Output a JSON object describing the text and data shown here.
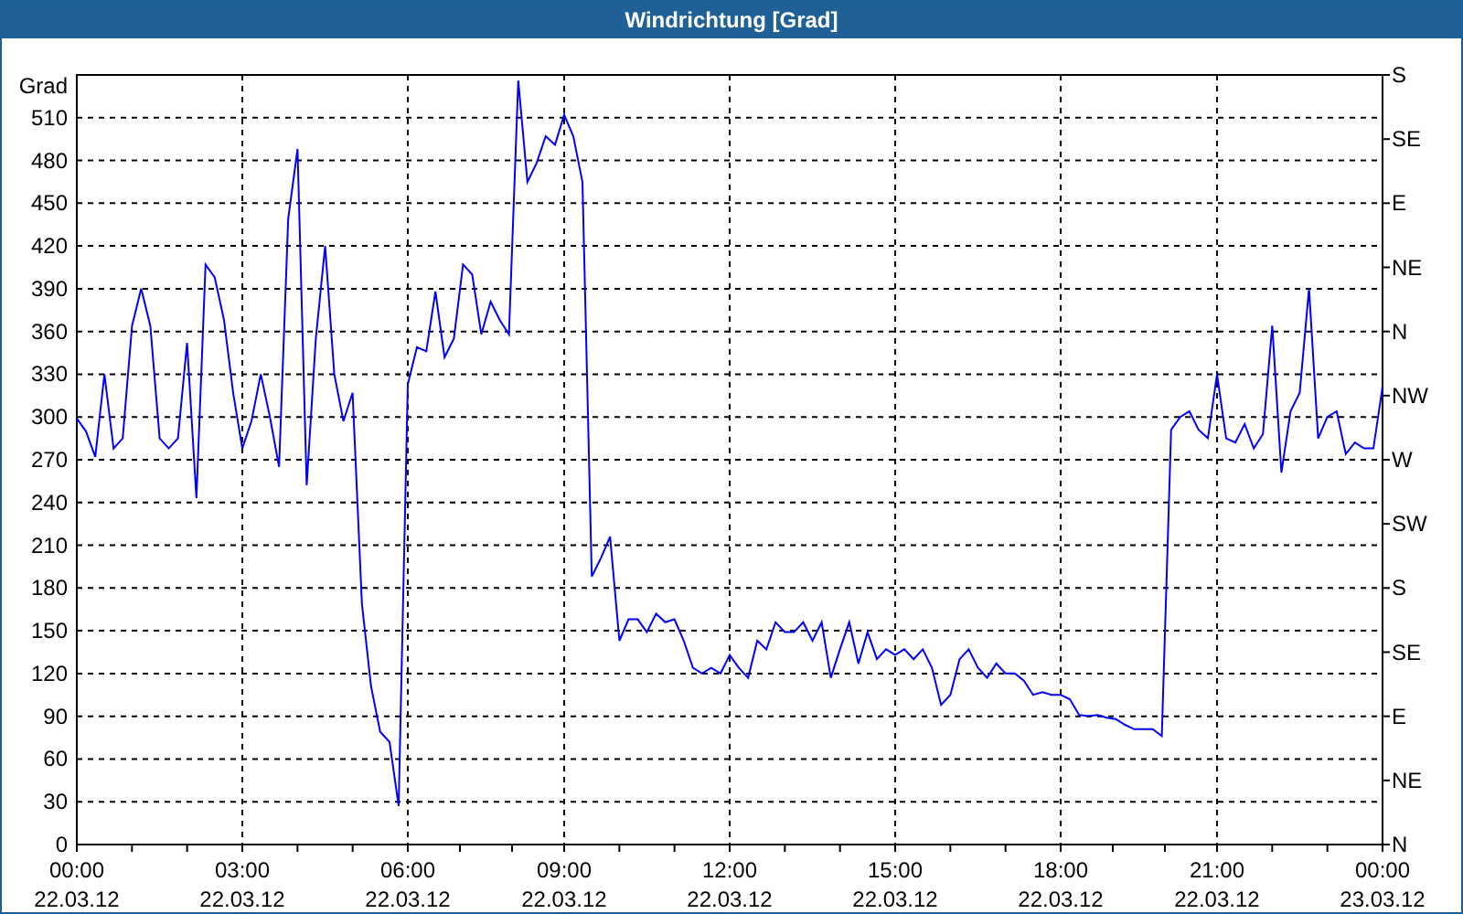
{
  "window": {
    "title": "Windrichtung [Grad]"
  },
  "chart": {
    "chart_data": {
      "type": "line",
      "ylabel": "Grad",
      "categories": [
        "00:00 22.03.12",
        null,
        null,
        null,
        null,
        null,
        null,
        null,
        null,
        null,
        null,
        null,
        null,
        null,
        null,
        null,
        null,
        null,
        "03:00 22.03.12",
        null,
        null,
        null,
        null,
        null,
        null,
        null,
        null,
        null,
        null,
        null,
        null,
        null,
        null,
        null,
        null,
        null,
        "06:00 22.03.12",
        null,
        null,
        null,
        null,
        null,
        null,
        null,
        null,
        null,
        null,
        null,
        null,
        null,
        null,
        null,
        null,
        "09:00 22.03.12",
        null,
        null,
        null,
        null,
        null,
        null,
        null,
        null,
        null,
        null,
        null,
        null,
        null,
        null,
        null,
        null,
        null,
        "12:00 22.03.12",
        null,
        null,
        null,
        null,
        null,
        null,
        null,
        null,
        null,
        null,
        null,
        null,
        null,
        null,
        null,
        null,
        null,
        "15:00 22.03.12",
        null,
        null,
        null,
        null,
        null,
        null,
        null,
        null,
        null,
        null,
        null,
        null,
        null,
        null,
        null,
        null,
        null,
        "18:00 22.03.12",
        null,
        null,
        null,
        null,
        null,
        null,
        null,
        null,
        null,
        null,
        null,
        null,
        null,
        null,
        null,
        null,
        "21:00 22.03.12",
        null,
        null,
        null,
        null,
        null,
        null,
        null,
        null,
        null,
        null,
        null,
        null,
        null,
        null,
        null,
        null,
        null,
        "00:00 23.03.12"
      ],
      "series": [
        {
          "color": "#0000ff",
          "values": [
            299,
            290,
            272,
            330,
            278,
            285,
            364,
            390,
            364,
            285,
            278,
            285,
            352,
            243,
            407,
            398,
            368,
            317,
            278,
            297,
            330,
            300,
            265,
            439,
            488,
            252,
            355,
            420,
            330,
            297,
            317,
            169,
            111,
            79,
            72,
            27,
            323,
            349,
            346,
            388,
            342,
            355,
            407,
            400,
            358,
            381,
            368,
            358,
            536,
            465,
            478,
            497,
            491,
            512,
            497,
            465,
            188,
            201,
            216,
            143,
            158,
            158,
            149,
            162,
            156,
            158,
            143,
            124,
            120,
            124,
            120,
            133,
            124,
            117,
            143,
            137,
            156,
            149,
            149,
            156,
            143,
            156,
            117,
            137,
            156,
            127,
            149,
            130,
            137,
            133,
            137,
            130,
            137,
            124,
            98,
            105,
            130,
            137,
            124,
            117,
            127,
            120,
            120,
            115,
            105,
            107,
            105,
            105,
            102,
            91,
            90,
            91,
            89,
            88,
            84,
            81,
            81,
            81,
            76,
            291,
            300,
            304,
            291,
            285,
            330,
            285,
            282,
            295,
            278,
            288,
            364,
            261,
            304,
            317,
            390,
            285,
            300,
            304,
            274,
            282,
            278,
            278,
            321
          ]
        }
      ],
      "grid": true,
      "ylim": [
        0,
        540
      ],
      "yticks": [
        0,
        30,
        60,
        90,
        120,
        150,
        180,
        210,
        240,
        270,
        300,
        330,
        360,
        390,
        420,
        450,
        480,
        510
      ]
    },
    "compass_axis": [
      "S",
      "SE",
      "E",
      "NE",
      "N",
      "NW",
      "W",
      "SW",
      "S",
      "SE",
      "E",
      "NE",
      "N"
    ]
  }
}
